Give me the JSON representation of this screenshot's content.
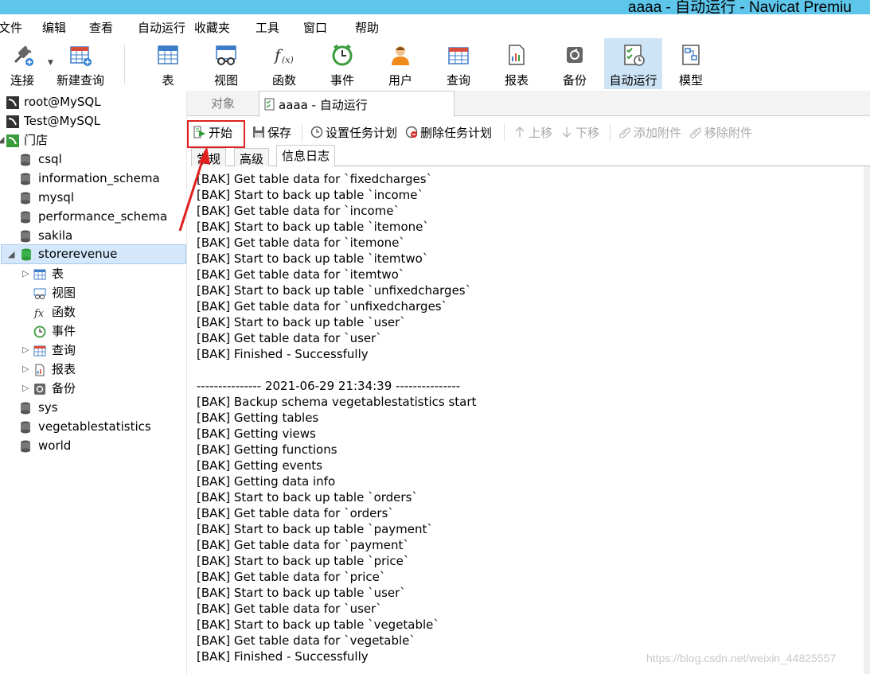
{
  "window": {
    "title": "aaaa - 自动运行 - Navicat Premiu"
  },
  "menu": [
    "文件",
    "编辑",
    "查看",
    "自动运行",
    "收藏夹",
    "工具",
    "窗口",
    "帮助"
  ],
  "toolbar": {
    "connect": "连接",
    "new_query": "新建查询",
    "table": "表",
    "view": "视图",
    "function": "函数",
    "event": "事件",
    "user": "用户",
    "query": "查询",
    "report": "报表",
    "backup": "备份",
    "automation": "自动运行",
    "model": "模型"
  },
  "tree": {
    "connections": [
      "root@MySQL",
      "Test@MySQL",
      "门店"
    ],
    "databases": [
      "csql",
      "information_schema",
      "mysql",
      "performance_schema",
      "sakila",
      "storerevenue"
    ],
    "children": [
      "表",
      "视图",
      "函数",
      "事件",
      "查询",
      "报表",
      "备份"
    ],
    "more_databases": [
      "sys",
      "vegetablestatistics",
      "world"
    ]
  },
  "tabs": {
    "objects": "对象",
    "active": "aaaa - 自动运行"
  },
  "actions": {
    "start": "开始",
    "save": "保存",
    "set_schedule": "设置任务计划",
    "delete_schedule": "删除任务计划",
    "move_up": "上移",
    "move_down": "下移",
    "add_attachment": "添加附件",
    "remove_attachment": "移除附件"
  },
  "subtabs": [
    "常规",
    "高级",
    "信息日志"
  ],
  "log": [
    "[BAK] Get table data for `fixedcharges`",
    "[BAK] Start to back up table `income`",
    "[BAK] Get table data for `income`",
    "[BAK] Start to back up table `itemone`",
    "[BAK] Get table data for `itemone`",
    "[BAK] Start to back up table `itemtwo`",
    "[BAK] Get table data for `itemtwo`",
    "[BAK] Start to back up table `unfixedcharges`",
    "[BAK] Get table data for `unfixedcharges`",
    "[BAK] Start to back up table `user`",
    "[BAK] Get table data for `user`",
    "[BAK] Finished - Successfully",
    "",
    "--------------- 2021-06-29 21:34:39 ---------------",
    "[BAK] Backup schema vegetablestatistics start",
    "[BAK] Getting tables",
    "[BAK] Getting views",
    "[BAK] Getting functions",
    "[BAK] Getting events",
    "[BAK] Getting data info",
    "[BAK] Start to back up table `orders`",
    "[BAK] Get table data for `orders`",
    "[BAK] Start to back up table `payment`",
    "[BAK] Get table data for `payment`",
    "[BAK] Start to back up table `price`",
    "[BAK] Get table data for `price`",
    "[BAK] Start to back up table `user`",
    "[BAK] Get table data for `user`",
    "[BAK] Start to back up table `vegetable`",
    "[BAK] Get table data for `vegetable`",
    "[BAK] Finished - Successfully"
  ],
  "watermark": "https://blog.csdn.net/weixin_44825557"
}
